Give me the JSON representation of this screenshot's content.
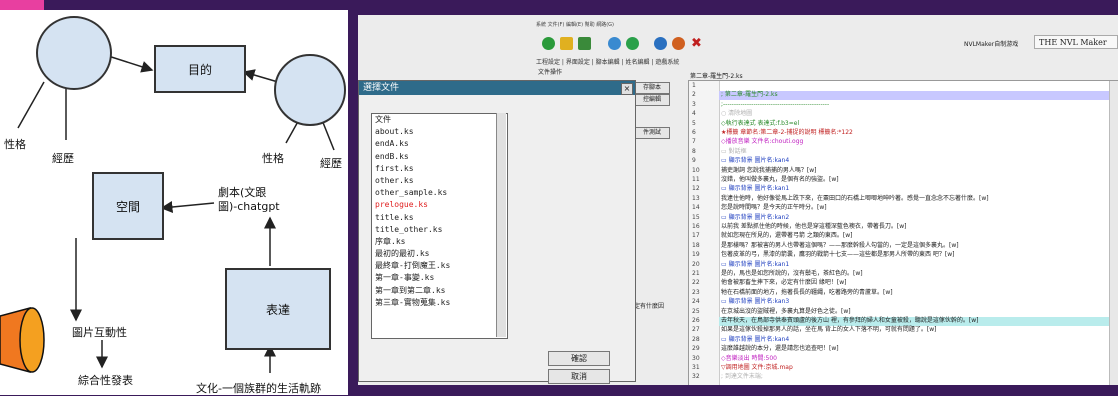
{
  "diagram": {
    "node_goal": "目的",
    "node_space": "空間",
    "node_expr": "表達",
    "label_personality_left": "性格",
    "label_experience_left": "經歷",
    "label_personality_right": "性格",
    "label_experience_right": "經歷",
    "label_script": "劇本(文跟\n圖)-chatgpt",
    "label_image_interact": "圖片互動性",
    "label_publish": "綜合性發表",
    "label_culture": "文化-一個族群的生活軌跡"
  },
  "app": {
    "menubar": "系統   文件(F)   編輯(E)   幫助   網路(G)",
    "tabs": "工程設定 | 界面設定 | 腳本編輯 | 姓名編輯 | 遊戲系統",
    "brand": "NVLMaker自制游戏",
    "brand2": "THE NVL Maker",
    "left_panel_title": "文件操作",
    "editor_tab": "第二章-羅生門-2.ks",
    "side_btn1": "存腳本",
    "side_btn2": "控編輯",
    "side_btn3": "件測試",
    "side_text": "定有什麼因",
    "lines": [
      {
        "n": "1",
        "t": "",
        "c": "#222"
      },
      {
        "n": "2",
        "t": "; 第二章-羅生門-2.ks",
        "c": "#2a8a2a"
      },
      {
        "n": "3",
        "t": ";-------------------------------------------------",
        "c": "#2a8a2a"
      },
      {
        "n": "4",
        "t": "○ 清除地圖",
        "c": "#b0b0b0"
      },
      {
        "n": "5",
        "t": "◇執行表達式  表達式:f.b3=el",
        "c": "#2a8a2a"
      },
      {
        "n": "6",
        "t": "★標籤  章節名:第二章-2-捕捉的說明  標籤名:*122",
        "c": "#c02020"
      },
      {
        "n": "7",
        "t": "◇播放音樂  文件名:chouti.ogg",
        "c": "#c020c0"
      },
      {
        "n": "8",
        "t": "▭ 對話框",
        "c": "#b0b0b0"
      },
      {
        "n": "9",
        "t": "▭ 顯示背景  圖片名:kan4",
        "c": "#2040c0"
      },
      {
        "n": "10",
        "t": "捕吏謝詞  您說我捕捕的男人嗎？[w]",
        "c": "#222"
      },
      {
        "n": "11",
        "t": "沒錯，他叫做多襄丸，是個有名的強盜。[w]",
        "c": "#222"
      },
      {
        "n": "12",
        "t": "▭ 顯示背景  圖片名:kan1",
        "c": "#2040c0"
      },
      {
        "n": "13",
        "t": "我逮住他時，他好像從馬上跌下來，在粟田口的石橋上唧唧地呻吟著。感覺一直念念不忘著什麼。[w]",
        "c": "#222"
      },
      {
        "n": "14",
        "t": "您是說時間嗎？是今天的正午時分。[w]",
        "c": "#222"
      },
      {
        "n": "15",
        "t": "▭ 顯示背景  圖片名:kan2",
        "c": "#2040c0"
      },
      {
        "n": "16",
        "t": "以前我  差點抓住他的時候，他也是穿這種深藍色襖衣，帶著長刀。[w]",
        "c": "#222"
      },
      {
        "n": "17",
        "t": "就如您現在所見的，還帶著弓箭  之類的東西。[w]",
        "c": "#222"
      },
      {
        "n": "18",
        "t": "是那樣嗎？那被害的男人也帶著這個嗎？——那麼幹殺人勾當的，一定是這個多襄丸。[w]",
        "c": "#222"
      },
      {
        "n": "19",
        "t": "包著皮革的弓，黑漆的箭囊，鷹羽的戰箭十七支——這些都是那男人所帶的東西  吧？[w]",
        "c": "#222"
      },
      {
        "n": "20",
        "t": "▭ 顯示背景  圖片名:kan1",
        "c": "#2040c0"
      },
      {
        "n": "21",
        "t": "是的，馬也是如您所說的，沒有鬃毛，茶紅色的。[w]",
        "c": "#222"
      },
      {
        "n": "22",
        "t": "他會被那畜生摔下來，必定有什麼因  緣吧！[w]",
        "c": "#222"
      },
      {
        "n": "23",
        "t": "牠在石橋前面的地方，拖著長長的韁繩，吃著路旁的青蘆草。[w]",
        "c": "#222"
      },
      {
        "n": "24",
        "t": "▭ 顯示背景  圖片名:kan3",
        "c": "#2040c0"
      },
      {
        "n": "25",
        "t": "在京城出沒的盜賊裡，多襄丸算是好色之徒。[w]",
        "c": "#222"
      },
      {
        "n": "26",
        "t": "去年秋天，在鳥部寺供奉賓頭盧的後方山  裡，有參拜的婦人和女童被殺，聽說是這傢伙幹的。[w]",
        "c": "#222"
      },
      {
        "n": "27",
        "t": "如果是這傢伙殺掉那男人的話，坐在馬  背上的女人下落不明，可就有問題了。[w]",
        "c": "#222"
      },
      {
        "n": "28",
        "t": "▭ 顯示背景  圖片名:kan4",
        "c": "#2040c0"
      },
      {
        "n": "29",
        "t": "這麼誰越說的本分，還是請您也追查吧！[w]",
        "c": "#222"
      },
      {
        "n": "30",
        "t": "◇音樂淡出  時間:500",
        "c": "#c020c0"
      },
      {
        "n": "31",
        "t": "▽調用地圖  文件:京城.map",
        "c": "#c02020"
      },
      {
        "n": "32",
        "t": "; 到達文件末端;",
        "c": "#b0b0b0"
      }
    ]
  },
  "dialog": {
    "title": "選擇文件",
    "close": "×",
    "list_header": "文件",
    "files": [
      "about.ks",
      "endA.ks",
      "endB.ks",
      "first.ks",
      "other.ks",
      "other_sample.ks",
      "prelogue.ks",
      "title.ks",
      "title_other.ks",
      "序章.ks",
      "最初的最初.ks",
      "最終章-打倒魔王.ks",
      "第一章-事變.ks",
      "第一章到第二章.ks",
      "第三章-實物蒐集.ks"
    ],
    "selected_file": "prelogue.ks",
    "ok": "確認",
    "cancel": "取消"
  },
  "colors": {
    "highlight_row": "#b9ecec",
    "selected_row": "#c8c8ff",
    "accent": "#e83fa0"
  }
}
